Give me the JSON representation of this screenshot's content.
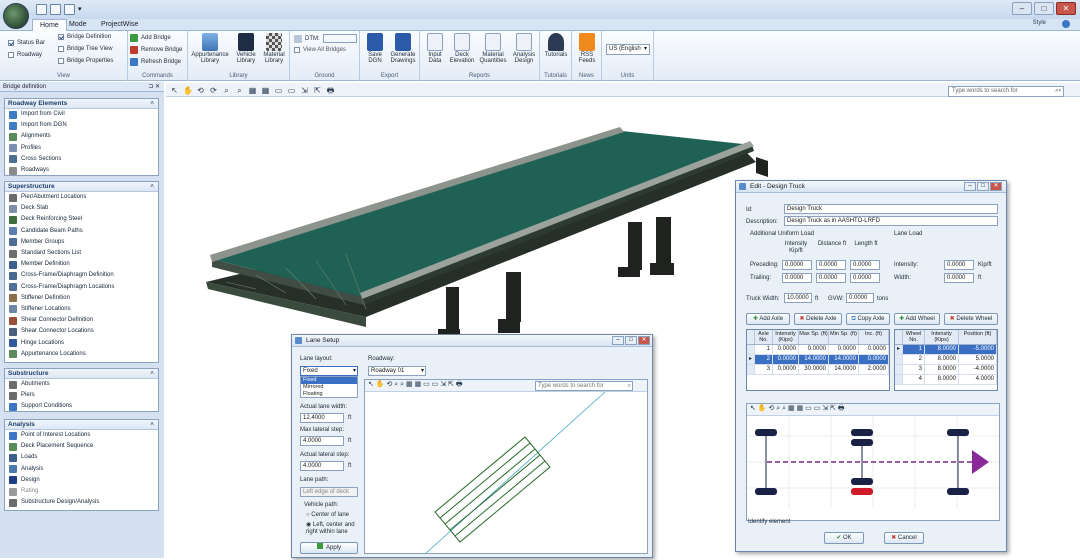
{
  "ribbon": {
    "tabs": [
      "Home",
      "Mode",
      "ProjectWise"
    ],
    "style_label": "Style",
    "view": {
      "label": "View",
      "status_bar": "Status Bar",
      "roadway": "Roadway",
      "bridge_definition": "Bridge Definition",
      "bridge_tree_view": "Bridge Tree View",
      "bridge_properties": "Bridge Properties"
    },
    "commands": {
      "label": "Commands",
      "add": "Add Bridge",
      "remove": "Remove Bridge",
      "refresh": "Refresh Bridge"
    },
    "library": {
      "label": "Library",
      "appurtenance": "Appurtenance Library",
      "vehicle": "Vehicle Library",
      "material": "Material Library"
    },
    "ground": {
      "label": "Ground",
      "dtm": "DTM:",
      "view_all": "View All Bridges"
    },
    "export": {
      "label": "Export",
      "save_dgn": "Save DGN",
      "generate": "Generate Drawings"
    },
    "reports": {
      "label": "Reports",
      "input": "Input Data",
      "deck": "Deck Elevation",
      "material": "Material Quantities",
      "analysis": "Analysis Design"
    },
    "tutorials": {
      "label": "Tutorials",
      "item": "Tutorials"
    },
    "news": {
      "label": "News",
      "rss": "RSS Feeds"
    },
    "units": {
      "label": "Units",
      "value": "US (English"
    }
  },
  "panel": {
    "title": "Bridge definition",
    "sections": [
      {
        "title": "Roadway Elements",
        "items": [
          "Import from Civil",
          "Import from DGN",
          "Alignments",
          "Profiles",
          "Cross Sections",
          "Roadways"
        ]
      },
      {
        "title": "Superstructure",
        "items": [
          "Pier/Abutment Locations",
          "Deck Slab",
          "Deck Reinforcing Steel",
          "Candidate Beam Paths",
          "Member Groups",
          "Standard Sections List",
          "Member Definition",
          "Cross-Frame/Diaphragm Definition",
          "Cross-Frame/Diaphragm Locations",
          "Stiffener Definition",
          "Stiffener Locations",
          "Shear Connector Definition",
          "Shear Connector Locations",
          "Hinge Locations",
          "Appurtenance Locations"
        ]
      },
      {
        "title": "Substructure",
        "items": [
          "Abutments",
          "Piers",
          "Support Conditions"
        ]
      },
      {
        "title": "Analysis",
        "items": [
          "Point of Interest Locations",
          "Deck Placement Sequence",
          "Loads",
          "Analysis",
          "Design",
          "Rating",
          "Substructure Design/Analysis"
        ]
      }
    ]
  },
  "viewport": {
    "search_placeholder": "Type words to search for"
  },
  "truck_dialog": {
    "title": "Edit - Design Truck",
    "id_label": "Id:",
    "id_value": "Design Truck",
    "desc_label": "Description:",
    "desc_value": "Design Truck as in AASHTO-LRFD",
    "uniform_label": "Additional Uniform Load",
    "col_intensity": "Intensity Kip/ft",
    "col_distance": "Distance ft",
    "col_length": "Length ft",
    "preceding_label": "Preceding:",
    "trailing_label": "Trailing:",
    "preceding": [
      "0.0000",
      "0.0000",
      "0.0000"
    ],
    "trailing": [
      "0.0000",
      "0.0000",
      "0.0000"
    ],
    "lane_load_label": "Lane Load",
    "intensity_label": "Intensity:",
    "intensity_value": "0.0000",
    "intensity_unit": "Kip/ft",
    "width_label": "Width:",
    "width_value": "0.0000",
    "width_unit": "ft",
    "truck_width_label": "Truck Width:",
    "truck_width_value": "10.0000",
    "truck_width_unit": "ft",
    "gvw_label": "GVW:",
    "gvw_value": "0.0000",
    "gvw_unit": "tons",
    "add_axle": "Add Axle",
    "delete_axle": "Delete Axle",
    "copy_axle": "Copy Axle",
    "add_wheel": "Add Wheel",
    "delete_wheel": "Delete Wheel",
    "axle_headers": [
      "Axle No.",
      "Intensity (Kips)",
      "Max Sp. (ft)",
      "Min Sp. (ft)",
      "Inc. (ft)"
    ],
    "axle_rows": [
      [
        "1",
        "0.0000",
        "0.0000",
        "0.0000",
        "0.0000"
      ],
      [
        "2",
        "0.0000",
        "14.0000",
        "14.0000",
        "0.0000"
      ],
      [
        "3",
        "0.0000",
        "30.0000",
        "14.0000",
        "2.0000"
      ]
    ],
    "wheel_headers": [
      "Wheel No.",
      "Intensity (Kips)",
      "Position (ft)"
    ],
    "wheel_rows": [
      [
        "1",
        "8.0000",
        "-5.0000"
      ],
      [
        "2",
        "8.0000",
        "5.0000"
      ],
      [
        "3",
        "8.0000",
        "-4.0000"
      ],
      [
        "4",
        "8.0000",
        "4.0000"
      ]
    ],
    "identify": "Identify element",
    "ok": "OK",
    "cancel": "Cancel"
  },
  "lane_dialog": {
    "title": "Lane Setup",
    "lane_layout_label": "Lane layout:",
    "lane_layout_value": "Fixed",
    "options": [
      "Fixed",
      "Mirrored",
      "Floating"
    ],
    "roadway_label": "Roadway:",
    "roadway_value": "Roadway 01",
    "actual_width_label": "Actual lane width:",
    "actual_width_value": "12.4000",
    "actual_width_unit": "ft",
    "max_step_label": "Max lateral step:",
    "max_step_value": "4.0000",
    "max_step_unit": "ft",
    "actual_step_label": "Actual lateral step:",
    "actual_step_value": "4.0000",
    "actual_step_unit": "ft",
    "lane_path_label": "Lane path:",
    "lane_path_value": "Left edge of deck",
    "vehicle_path_label": "Vehicle path:",
    "radio1": "Center of lane",
    "radio2": "Left, center and right within lane",
    "apply": "Apply",
    "search_placeholder": "Type words to search for"
  },
  "colors": {
    "deck": "#1f6155",
    "girder": "#2e3a30",
    "selection": "#3b6fc4",
    "ribbon_bg": "#e3ecf7"
  }
}
